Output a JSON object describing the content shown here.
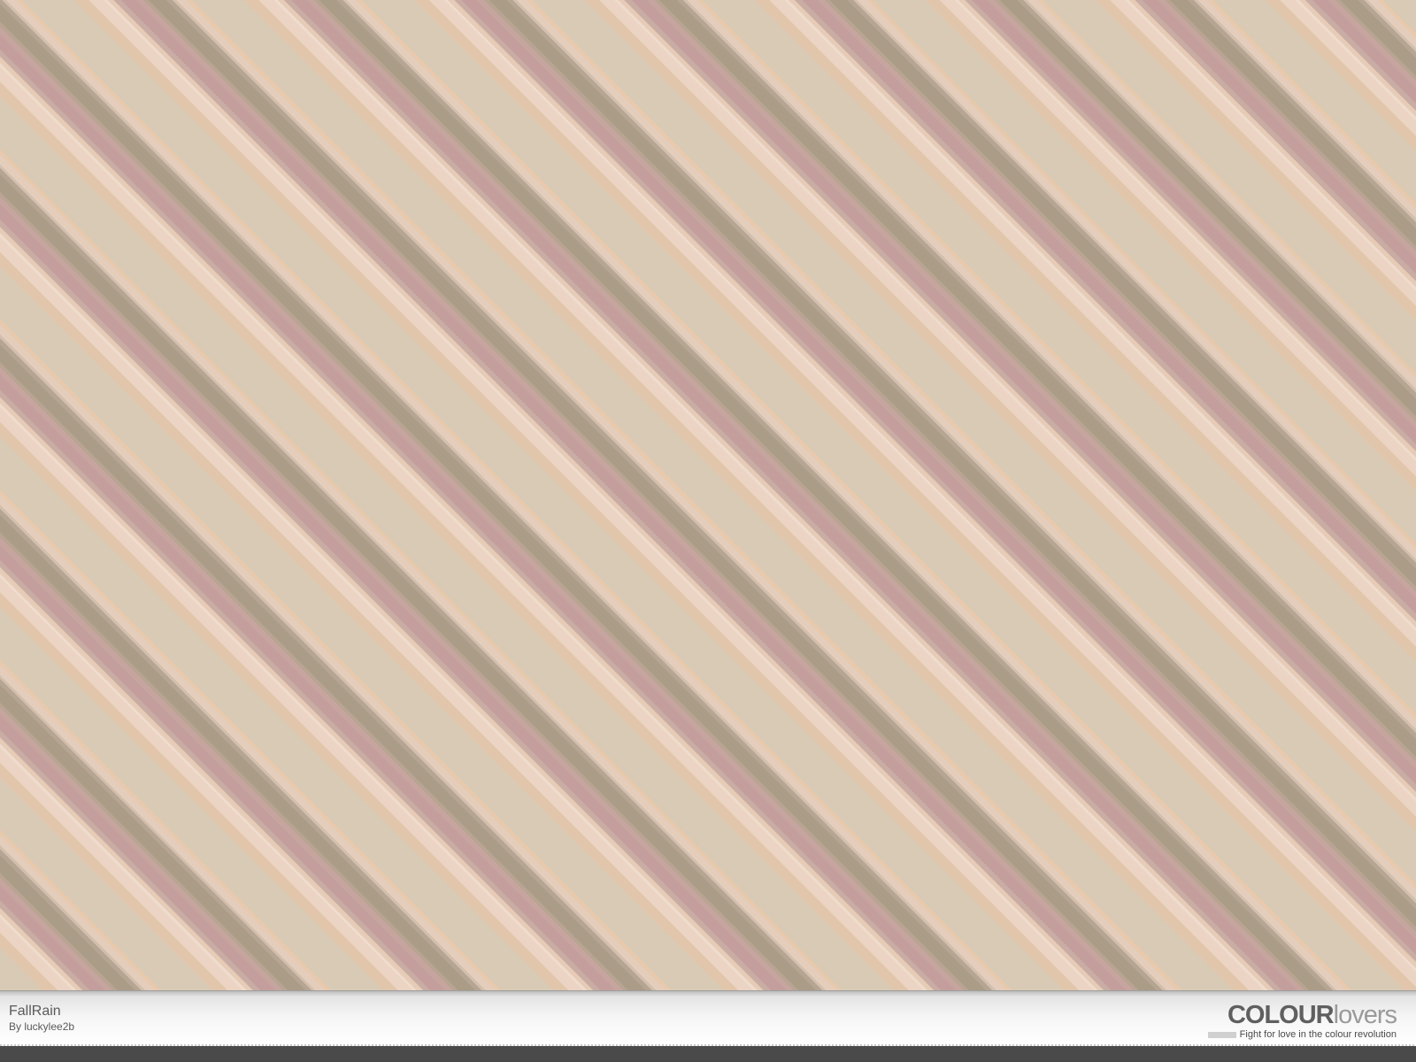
{
  "palette": {
    "title": "FallRain",
    "author": "By luckylee2b"
  },
  "branding": {
    "logo_strong": "COLOUR",
    "logo_light": "lovers",
    "tagline": "Fight for love in the colour revolution"
  },
  "colors": {
    "stripe_beige": "#d8cab4",
    "stripe_peach": "#e2c6ac",
    "stripe_light_pink": "#ebd4c3",
    "stripe_mauve": "#c49e9c",
    "stripe_taupe": "#ab9c87",
    "footer_background": "#f6f6f6",
    "bottom_bar": "#4a4a4a"
  }
}
